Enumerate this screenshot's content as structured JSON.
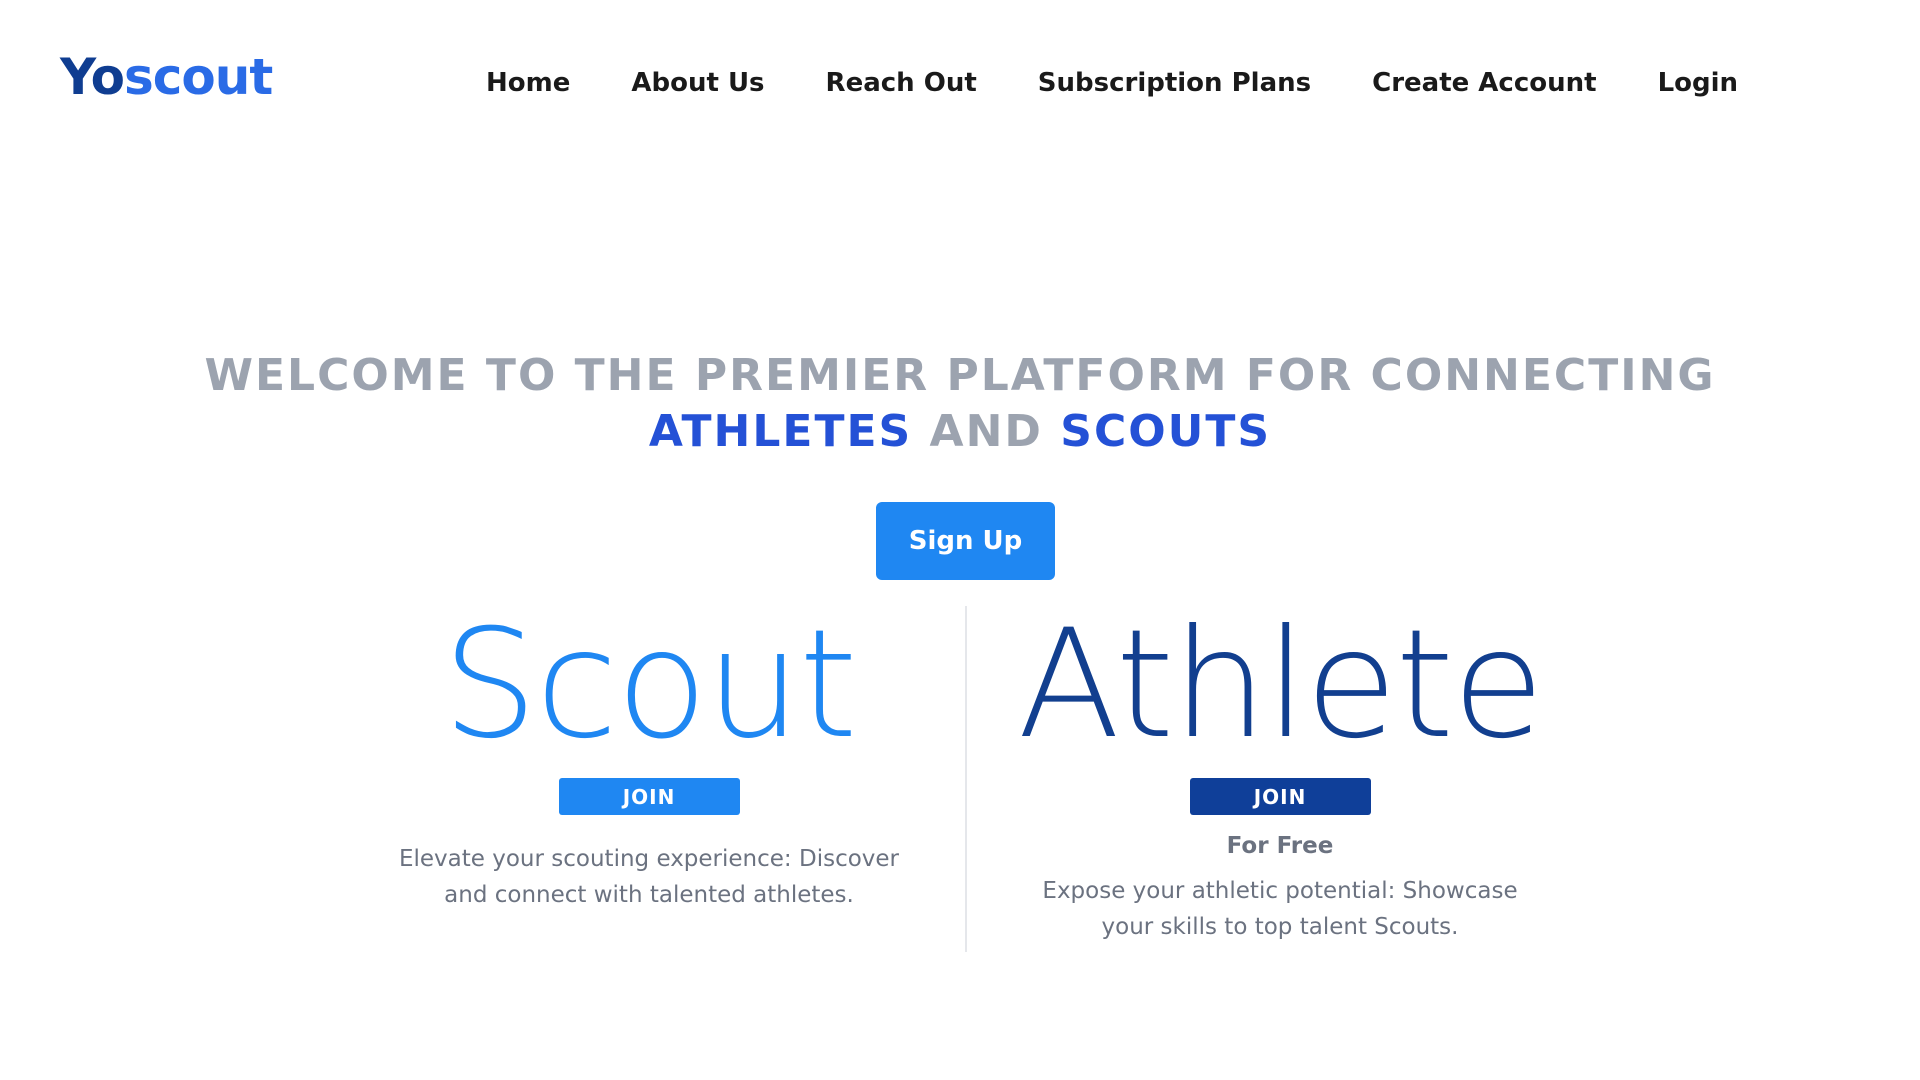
{
  "header": {
    "logo": {
      "part1": "Yo",
      "part2": "scout"
    },
    "nav": {
      "home": "Home",
      "about": "About Us",
      "reach_out": "Reach Out",
      "subscription_plans": "Subscription Plans",
      "create_account": "Create Account",
      "login": "Login"
    }
  },
  "hero": {
    "title_line1": "WELCOME TO THE PREMIER PLATFORM FOR CONNECTING",
    "title_athletes": "ATHLETES",
    "title_and": "AND",
    "title_scouts": "SCOUTS",
    "signup_label": "Sign Up"
  },
  "panels": {
    "scout": {
      "title": "Scout",
      "join_label": "JOIN",
      "description": "Elevate your scouting experience: Discover and connect with talented athletes."
    },
    "athlete": {
      "title": "Athlete",
      "join_label": "JOIN",
      "note": "For Free",
      "description": "Expose your athletic potential: Showcase your skills to top talent Scouts."
    }
  },
  "colors": {
    "brand_dark": "#0f3d91",
    "brand_light": "#2a6be6",
    "scout_blue": "#1f87f2",
    "athlete_navy": "#123f8f",
    "muted_gray": "#9ca3af"
  }
}
